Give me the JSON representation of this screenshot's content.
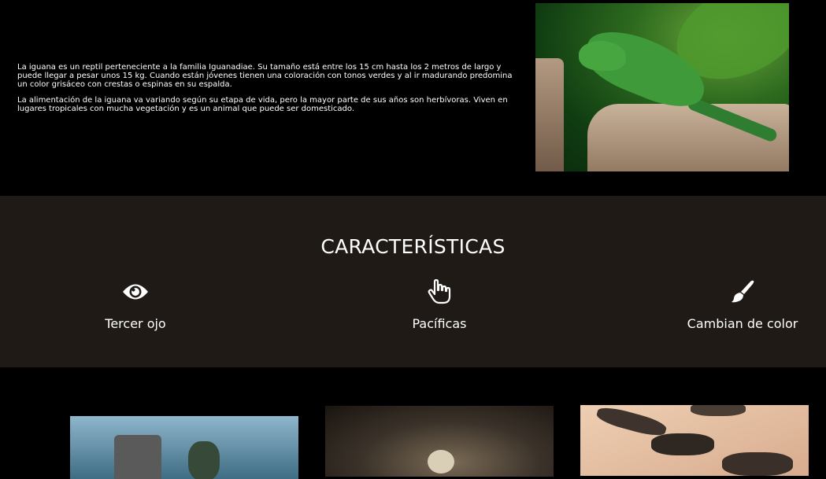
{
  "intro": {
    "paragraphs": [
      "La iguana es un reptil perteneciente a la familia Iguanadiae. Su tamaño está entre los 15 cm hasta los 2 metros de largo y puede llegar a pesar unos 15 kg. Cuando están jóvenes tienen una coloración con tonos verdes y al ir madurando predomina un color grisáceo con crestas o espinas en su espalda.",
      "La alimentación de la iguana va variando según su etapa de vida, pero la mayor parte de sus años son herbívoras. Viven en lugares tropicales con mucha vegetación y es un animal que puede ser domesticado."
    ]
  },
  "features": {
    "title": "CARACTERÍSTICAS",
    "items": [
      {
        "icon": "eye-icon",
        "label": "Tercer ojo"
      },
      {
        "icon": "hand-pointer-icon",
        "label": "Pacíficas"
      },
      {
        "icon": "paint-brush-icon",
        "label": "Cambian de color"
      }
    ]
  },
  "colors": {
    "page_background": "#000000",
    "features_background": "#1f1a15",
    "text": "#ffffff"
  }
}
